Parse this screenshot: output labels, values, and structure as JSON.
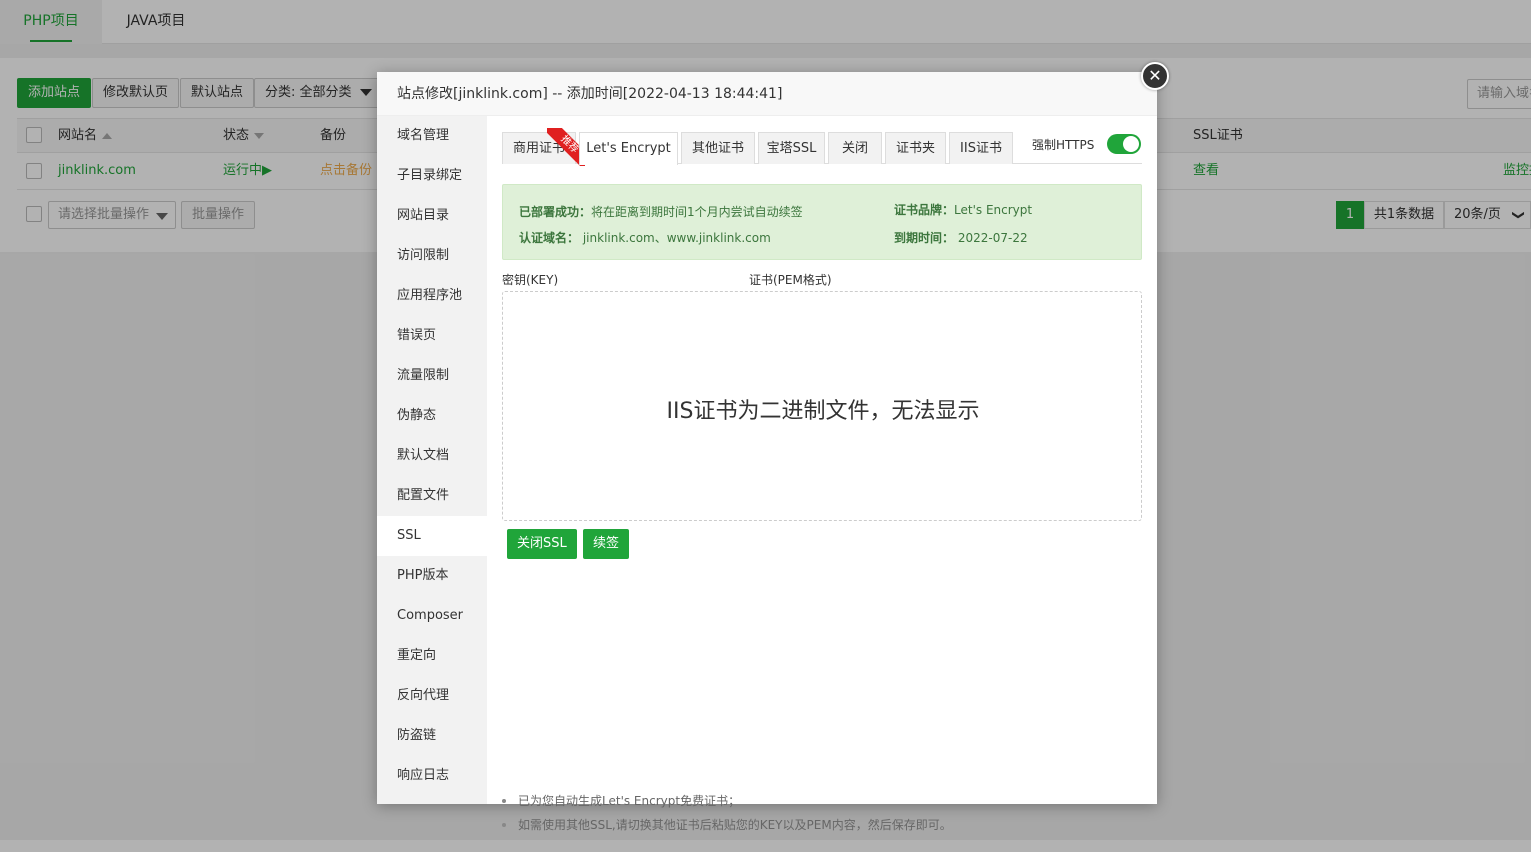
{
  "project_tabs": [
    "PHP项目",
    "JAVA项目"
  ],
  "toolbar": {
    "add_site": "添加站点",
    "edit_default_page": "修改默认页",
    "default_site": "默认站点",
    "category": "分类: 全部分类",
    "search_placeholder": "请输入域名"
  },
  "table": {
    "headers": {
      "site_name": "网站名",
      "status": "状态",
      "backup": "备份",
      "ssl": "SSL证书"
    },
    "row": {
      "site_name": "jinklink.com",
      "status": "运行中▶",
      "backup": "点击备份",
      "ssl": "查看",
      "monitor": "监控报表"
    }
  },
  "batch": {
    "select_placeholder": "请选择批量操作",
    "button": "批量操作"
  },
  "pagination": {
    "current": "1",
    "total": "共1条数据",
    "page_size": "20条/页",
    "chevron": "❯"
  },
  "modal": {
    "title": "站点修改[jinklink.com] -- 添加时间[2022-04-13 18:44:41]",
    "close_glyph": "✕",
    "sidebar": [
      "域名管理",
      "子目录绑定",
      "网站目录",
      "访问限制",
      "应用程序池",
      "错误页",
      "流量限制",
      "伪静态",
      "默认文档",
      "配置文件",
      "SSL",
      "PHP版本",
      "Composer",
      "重定向",
      "反向代理",
      "防盗链",
      "响应日志"
    ],
    "sidebar_active_index": 10,
    "tabs": [
      "商用证书",
      "Let's Encrypt",
      "其他证书",
      "宝塔SSL",
      "关闭",
      "证书夹",
      "IIS证书"
    ],
    "active_tab_index": 1,
    "ribbon": "推荐",
    "force_https_label": "强制HTTPS",
    "force_https_on": true,
    "info": {
      "deployed_label": "已部署成功：",
      "deployed_text": "将在距离到期时间1个月内尝试自动续签",
      "brand_label": "证书品牌：",
      "brand_value": "Let's Encrypt",
      "domain_label": "认证域名：",
      "domain_value": "jinklink.com、www.jinklink.com",
      "expire_label": "到期时间：",
      "expire_value": "2022-07-22"
    },
    "key_label": "密钥(KEY)",
    "cert_label": "证书(PEM格式)",
    "cert_message": "IIS证书为二进制文件，无法显示",
    "buttons": {
      "close_ssl": "关闭SSL",
      "renew": "续签"
    },
    "tips": [
      "已为您自动生成Let's Encrypt免费证书；",
      "如需使用其他SSL,请切换其他证书后粘贴您的KEY以及PEM内容，然后保存即可。"
    ]
  },
  "colors": {
    "accent": "#20a53a",
    "info_bg": "#dff0d8",
    "ribbon": "#e02020"
  }
}
